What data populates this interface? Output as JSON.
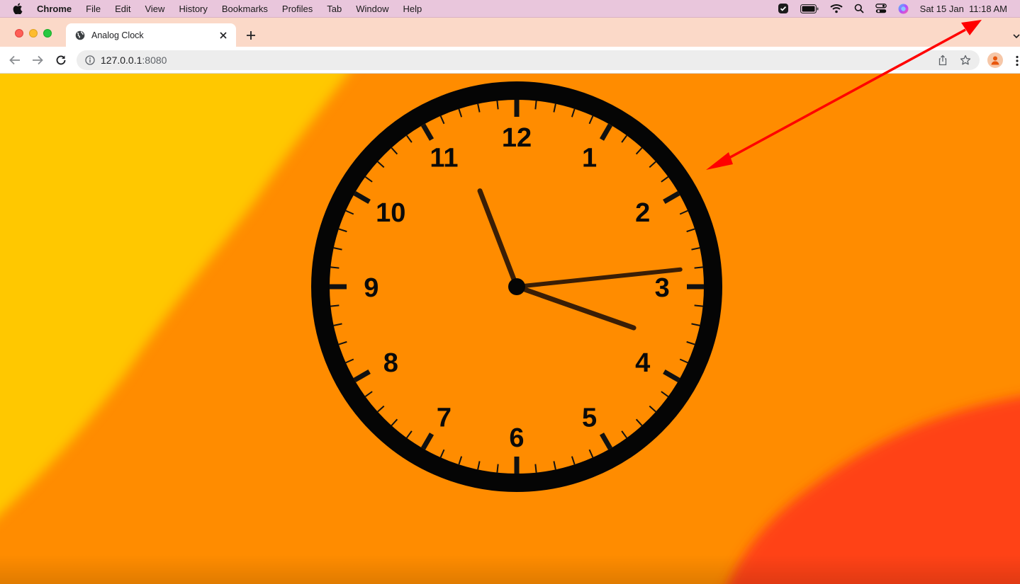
{
  "menubar": {
    "apple_icon": "apple-icon",
    "app_name": "Chrome",
    "items": [
      "File",
      "Edit",
      "View",
      "History",
      "Bookmarks",
      "Profiles",
      "Tab",
      "Window",
      "Help"
    ],
    "status_icons": [
      "shield-check-icon",
      "battery-icon",
      "wifi-icon",
      "search-icon",
      "control-center-icon",
      "siri-icon"
    ],
    "datetime": "Sat 15 Jan  11:18 AM"
  },
  "tab": {
    "title": "Analog Clock",
    "favicon": "globe-icon"
  },
  "toolbar": {
    "url_host": "127.0.0.1",
    "url_port": ":8080"
  },
  "clock": {
    "numerals": [
      "12",
      "1",
      "2",
      "3",
      "4",
      "5",
      "6",
      "7",
      "8",
      "9",
      "10",
      "11"
    ],
    "hour": 11,
    "minute": 18,
    "second": 14
  },
  "colors": {
    "wallpaper_orange": "#ff8c00",
    "wallpaper_yellow": "#ffc800",
    "wallpaper_red": "#ff4214",
    "annotation_arrow": "#ff0000",
    "menubar": "#e9c6dc",
    "tabstrip": "#fbd9c8"
  }
}
